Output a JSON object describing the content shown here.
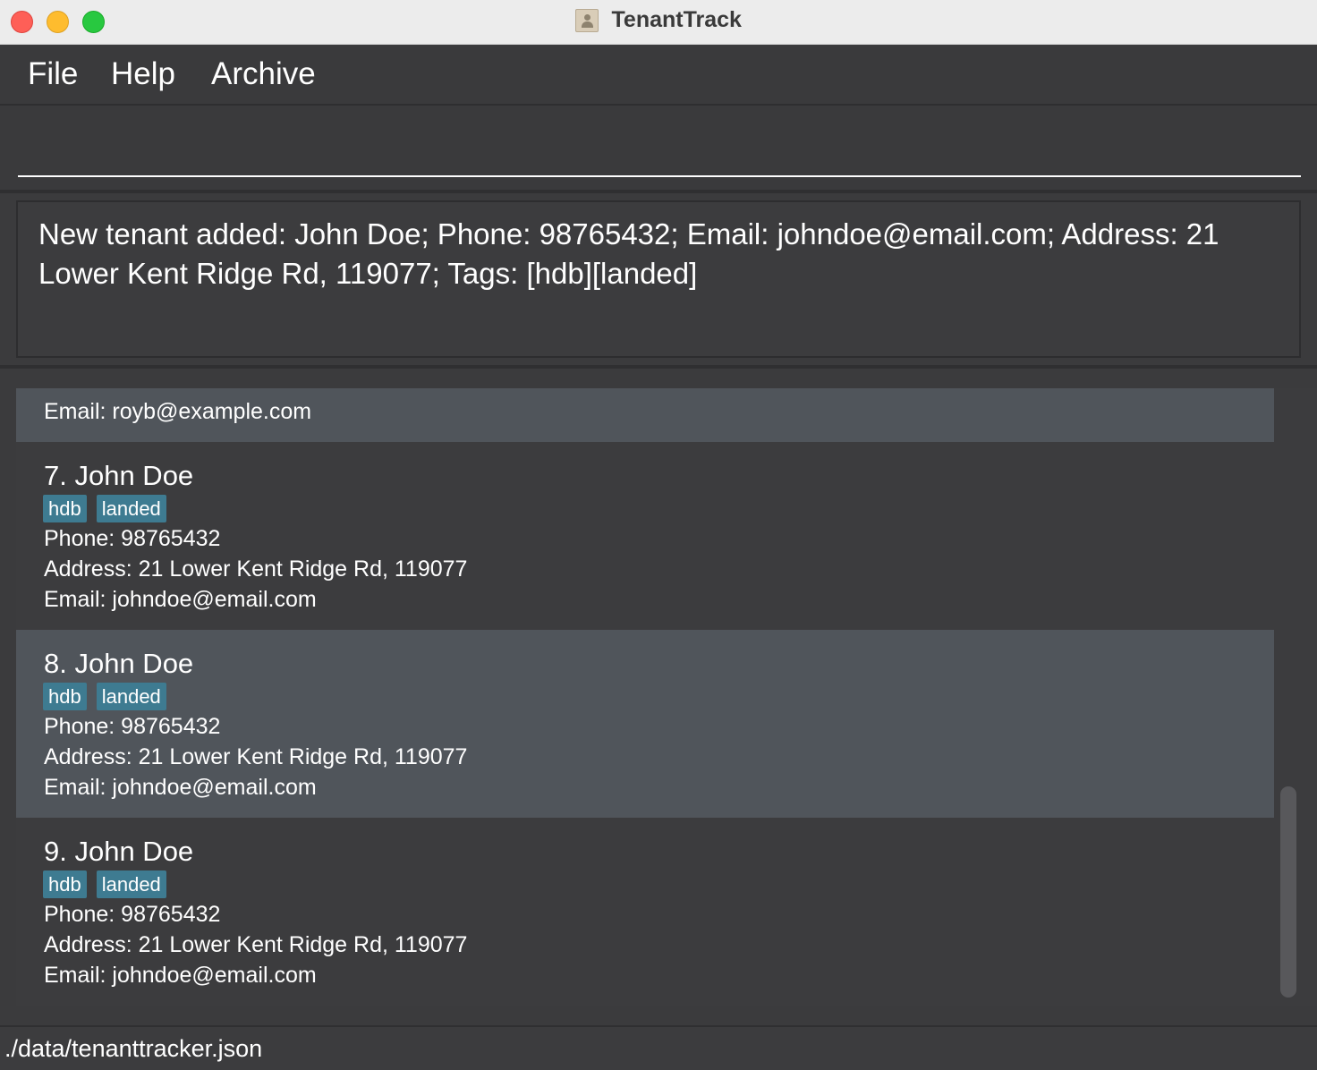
{
  "window": {
    "title": "TenantTrack"
  },
  "menu": {
    "items": [
      "File",
      "Help",
      "Archive"
    ]
  },
  "command": {
    "value": ""
  },
  "result": {
    "message": "New tenant added: John Doe; Phone: 98765432; Email: johndoe@email.com; Address: 21 Lower Kent Ridge Rd, 119077; Tags: [hdb][landed]"
  },
  "list": {
    "partial_card": {
      "email": "Email: royb@example.com"
    },
    "cards": [
      {
        "name": "7. John Doe",
        "tags": [
          "hdb",
          "landed"
        ],
        "phone": "Phone: 98765432",
        "address": "Address: 21 Lower Kent Ridge Rd, 119077",
        "email": "Email: johndoe@email.com"
      },
      {
        "name": "8. John Doe",
        "tags": [
          "hdb",
          "landed"
        ],
        "phone": "Phone: 98765432",
        "address": "Address: 21 Lower Kent Ridge Rd, 119077",
        "email": "Email: johndoe@email.com"
      },
      {
        "name": "9. John Doe",
        "tags": [
          "hdb",
          "landed"
        ],
        "phone": "Phone: 98765432",
        "address": "Address: 21 Lower Kent Ridge Rd, 119077",
        "email": "Email: johndoe@email.com"
      }
    ]
  },
  "status": {
    "path": "./data/tenanttracker.json"
  }
}
